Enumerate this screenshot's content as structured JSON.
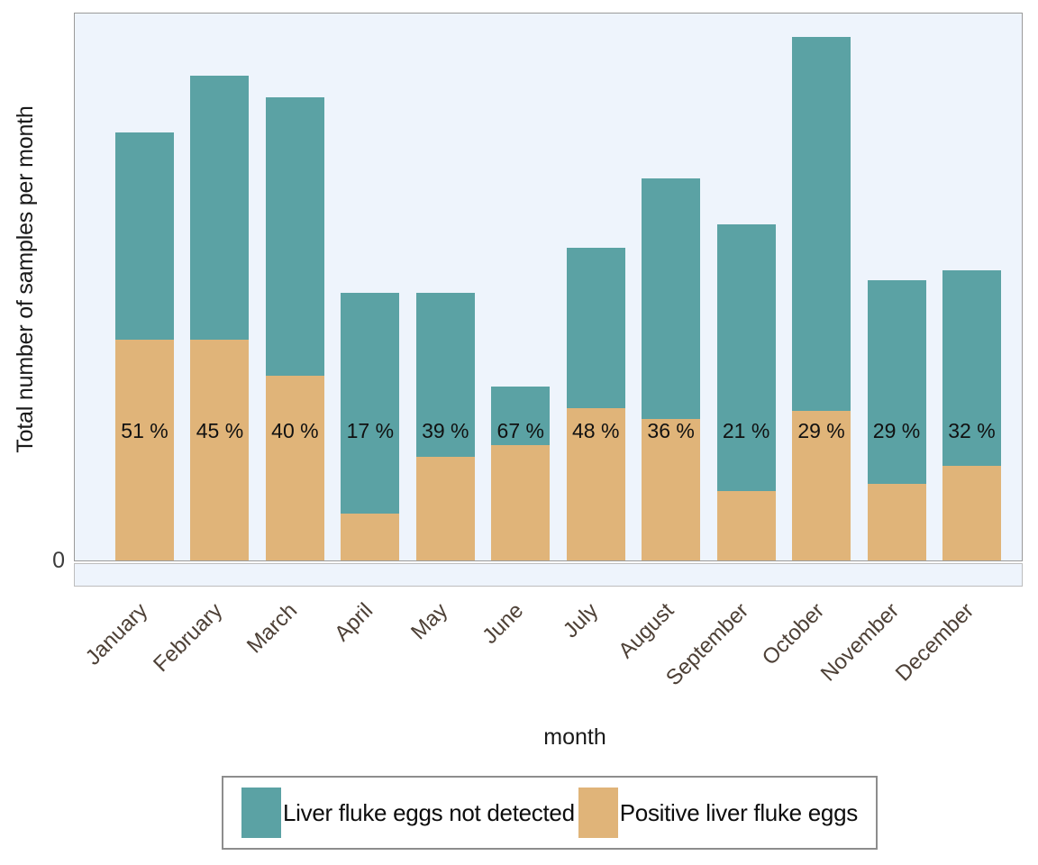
{
  "chart_data": {
    "type": "bar",
    "subtype": "stacked-bar",
    "title": "",
    "xlabel": "month",
    "ylabel": "Total number of samples per month",
    "categories": [
      "January",
      "February",
      "March",
      "April",
      "May",
      "June",
      "July",
      "August",
      "September",
      "October",
      "November",
      "December"
    ],
    "y_tick_labels": [
      "0"
    ],
    "y_ticks": [
      0
    ],
    "grid": false,
    "legend_position": "bottom",
    "series": [
      {
        "name": "Liver fluke eggs not detected",
        "color": "#5ba2a4",
        "values": [
          230,
          293,
          309,
          245,
          182,
          65,
          178,
          267,
          296,
          415,
          226,
          217
        ]
      },
      {
        "name": "Positive liver fluke eggs",
        "color": "#e0b479",
        "values": [
          245,
          245,
          205,
          52,
          115,
          128,
          169,
          157,
          77,
          166,
          85,
          105
        ]
      }
    ],
    "totals": [
      475,
      538,
      514,
      297,
      297,
      193,
      347,
      424,
      373,
      581,
      311,
      322
    ],
    "annotations": [
      "51 %",
      "45 %",
      "40 %",
      "17 %",
      "39 %",
      "67 %",
      "48 %",
      "36 %",
      "21 %",
      "29 %",
      "29 %",
      "32 %"
    ],
    "percent_values": [
      51,
      45,
      40,
      17,
      39,
      67,
      48,
      36,
      21,
      29,
      29,
      32
    ],
    "panel_background": "#eef4fc"
  },
  "legend": {
    "items": [
      {
        "label": "Liver fluke eggs not detected",
        "color": "#5ba2a4"
      },
      {
        "label": "Positive liver fluke eggs",
        "color": "#e0b479"
      }
    ]
  }
}
